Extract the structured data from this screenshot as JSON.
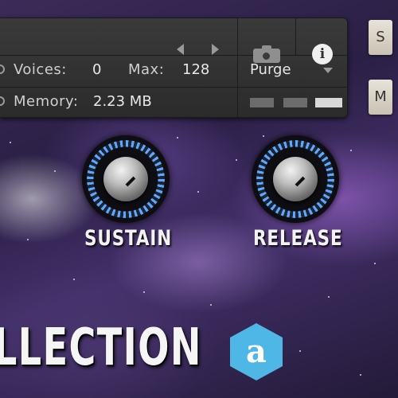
{
  "status": {
    "voices_label": "Voices:",
    "voices_value": "0",
    "max_label": "Max:",
    "max_value": "128",
    "memory_label": "Memory:",
    "memory_value": "2.23 MB"
  },
  "purge": {
    "label": "Purge"
  },
  "side_buttons": {
    "solo": "S",
    "mute": "M"
  },
  "knobs": {
    "sustain_label": "SUSTAIN",
    "release_label": "RELEASE"
  },
  "title": "LLECTION",
  "logo_text": "a",
  "colors": {
    "knob_led": "#5fa6ff",
    "logo": "#4fb7e6"
  }
}
